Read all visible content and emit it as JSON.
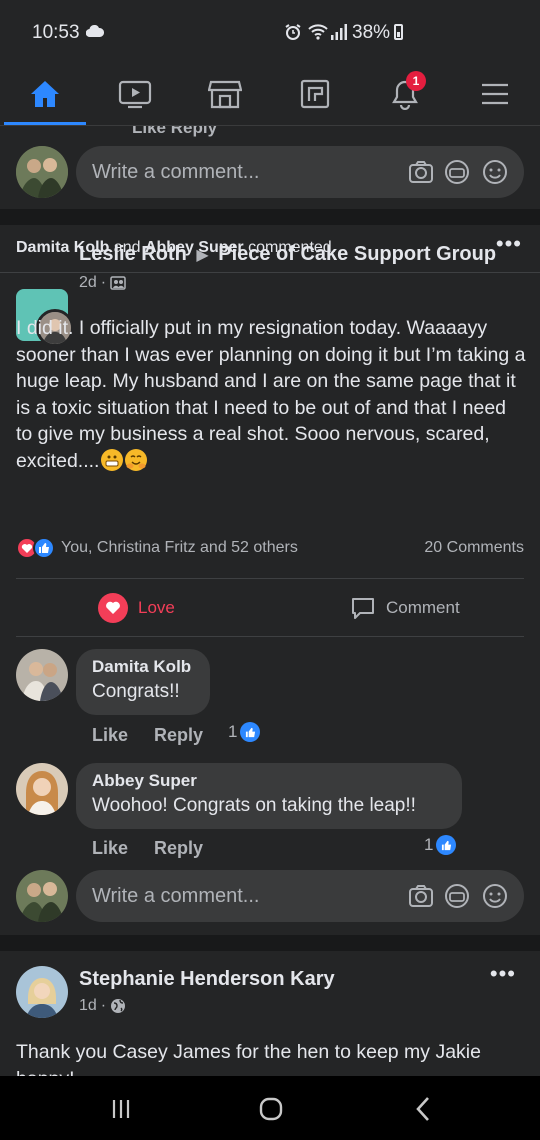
{
  "status": {
    "time": "10:53",
    "battery": "38%"
  },
  "nav": {
    "notification_count": "1"
  },
  "top_card": {
    "cut_text": "Like     Reply",
    "comment_placeholder": "Write a comment..."
  },
  "activity": {
    "user1": "Damita Kolb",
    "and": "and",
    "user2": "Abbey Super",
    "suffix": "commented."
  },
  "post": {
    "author": "Leslie Roth",
    "group": "Piece of Cake Support Group",
    "time": "2d",
    "body": "I did it. I officially put in my resignation today. Waaaayy sooner than I was ever planning on doing it but I’m taking a huge leap. My husband and I are on the same page that it is a toxic situation that I need to be out of and that I need to give my business a real shot. Sooo nervous, scared, excited....",
    "reactions_text": "You, Christina Fritz and 52 others",
    "comments_count": "20 Comments",
    "love_label": "Love",
    "comment_label": "Comment"
  },
  "comments": [
    {
      "name": "Damita Kolb",
      "text": "Congrats!!",
      "like": "Like",
      "reply": "Reply",
      "likes": "1"
    },
    {
      "name": "Abbey Super",
      "text": "Woohoo! Congrats on taking the leap!!",
      "like": "Like",
      "reply": "Reply",
      "likes": "1"
    }
  ],
  "comment_input": {
    "placeholder": "Write a comment..."
  },
  "next_post": {
    "author": "Stephanie Henderson Kary",
    "time": "1d",
    "body": "Thank you Casey James for the hen to keep my Jakie happy!"
  },
  "colors": {
    "accent": "#2d88ff",
    "love": "#f33e58",
    "badge": "#e41e3f",
    "background": "#18191a",
    "card": "#242526"
  }
}
